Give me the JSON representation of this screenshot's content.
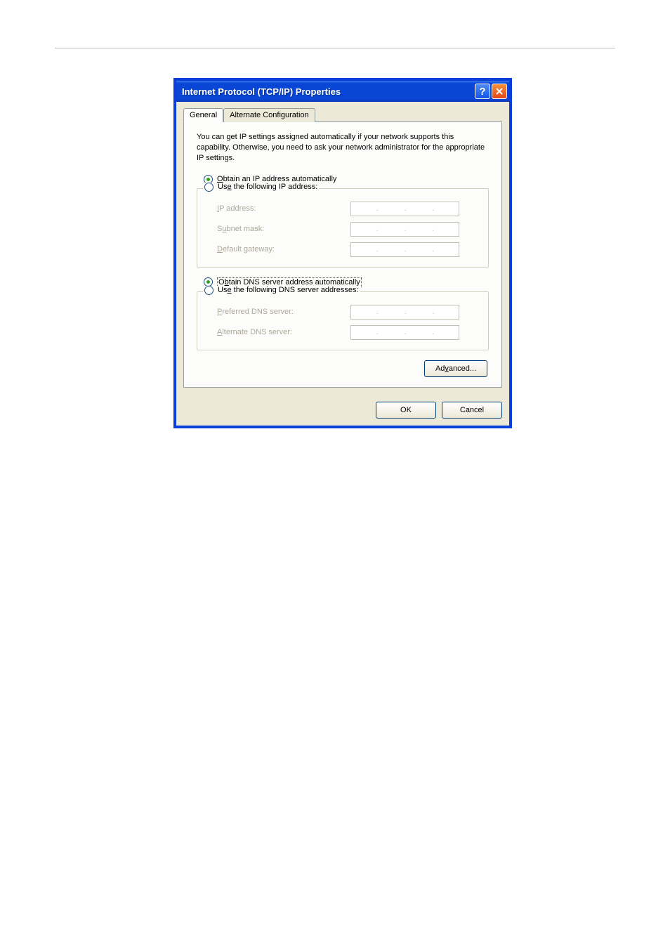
{
  "window": {
    "title": "Internet Protocol (TCP/IP) Properties",
    "help_icon": "?",
    "close_icon": "X"
  },
  "tabs": {
    "general": "General",
    "alt": "Alternate Configuration"
  },
  "intro": "You can get IP settings assigned automatically if your network supports this capability. Otherwise, you need to ask your network administrator for the appropriate IP settings.",
  "ip_section": {
    "auto_pre": "O",
    "auto_post": "btain an IP address automatically",
    "manual_pre": "Us",
    "manual_u": "e",
    "manual_post": " the following IP address:",
    "ip_u": "I",
    "ip_post": "P address:",
    "mask_pre": "S",
    "mask_u": "u",
    "mask_post": "bnet mask:",
    "gw_u": "D",
    "gw_post": "efault gateway:"
  },
  "dns_section": {
    "auto_pre": "O",
    "auto_u": "b",
    "auto_post": "tain DNS server address automatically",
    "manual_pre": "Us",
    "manual_u": "e",
    "manual_post": " the following DNS server addresses:",
    "pref_u": "P",
    "pref_post": "referred DNS server:",
    "alt_u": "A",
    "alt_post": "lternate DNS server:"
  },
  "buttons": {
    "advanced_pre": "Ad",
    "advanced_u": "v",
    "advanced_post": "anced...",
    "ok": "OK",
    "cancel": "Cancel"
  },
  "ip_placeholder": "."
}
